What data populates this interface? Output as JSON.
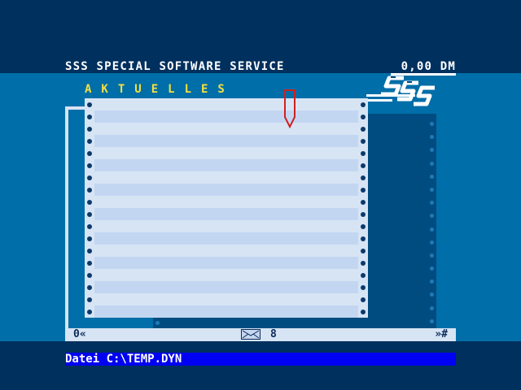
{
  "header": {
    "title": "SSS SPECIAL SOFTWARE SERVICE",
    "price": "0,00 DM"
  },
  "section": {
    "label": "AKTUELLES"
  },
  "logo": {
    "icon": "sss-logo-icon"
  },
  "status": {
    "left": "0«",
    "count": "8",
    "right": "»#",
    "mail_icon": "envelope-icon"
  },
  "file": {
    "label": "Datei C:\\TEMP.DYN"
  },
  "colors": {
    "background": "#00305e",
    "band": "#006ea8",
    "paper": "#d7e4f4",
    "paper_stripe": "#c2d6f2",
    "label_yellow": "#f4e040",
    "filebar_blue": "#0000f2",
    "cursor_red": "#d02020"
  }
}
